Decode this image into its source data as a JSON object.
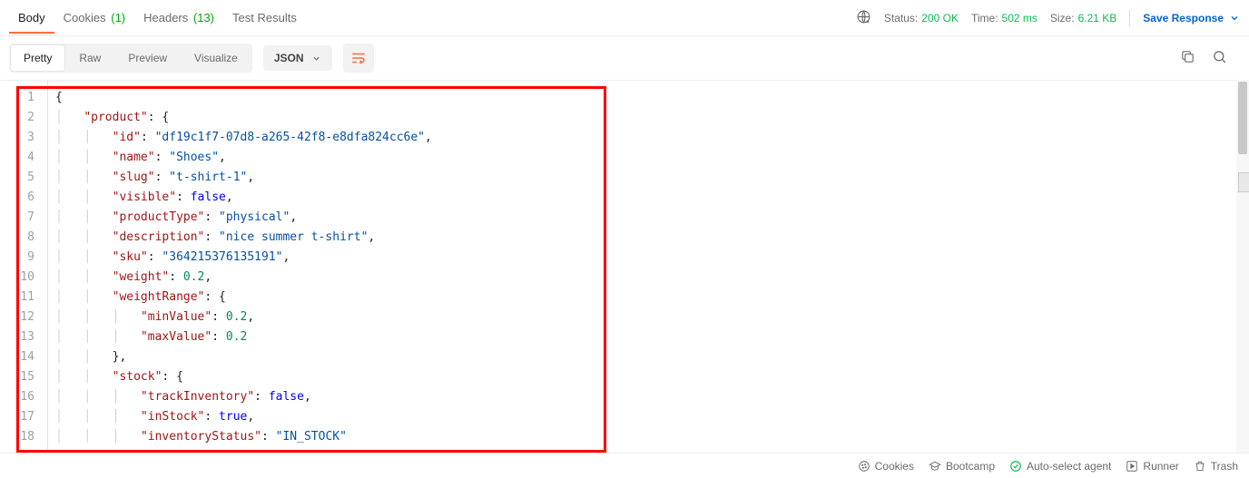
{
  "tabs": {
    "body": "Body",
    "cookies": {
      "label": "Cookies",
      "count": "(1)"
    },
    "headers": {
      "label": "Headers",
      "count": "(13)"
    },
    "test_results": "Test Results"
  },
  "status_bar": {
    "status_label": "Status:",
    "status_value": "200 OK",
    "time_label": "Time:",
    "time_value": "502 ms",
    "size_label": "Size:",
    "size_value": "6.21 KB",
    "save_response": "Save Response"
  },
  "view": {
    "pretty": "Pretty",
    "raw": "Raw",
    "preview": "Preview",
    "visualize": "Visualize",
    "format": "JSON"
  },
  "code_lines": [
    {
      "n": 1,
      "indent": 0,
      "tokens": [
        {
          "t": "punc",
          "v": "{"
        }
      ]
    },
    {
      "n": 2,
      "indent": 1,
      "tokens": [
        {
          "t": "key",
          "v": "\"product\""
        },
        {
          "t": "punc",
          "v": ": "
        },
        {
          "t": "punc",
          "v": "{"
        }
      ]
    },
    {
      "n": 3,
      "indent": 2,
      "tokens": [
        {
          "t": "key",
          "v": "\"id\""
        },
        {
          "t": "punc",
          "v": ": "
        },
        {
          "t": "str",
          "v": "\"df19c1f7-07d8-a265-42f8-e8dfa824cc6e\""
        },
        {
          "t": "punc",
          "v": ","
        }
      ]
    },
    {
      "n": 4,
      "indent": 2,
      "tokens": [
        {
          "t": "key",
          "v": "\"name\""
        },
        {
          "t": "punc",
          "v": ": "
        },
        {
          "t": "str",
          "v": "\"Shoes\""
        },
        {
          "t": "punc",
          "v": ","
        }
      ]
    },
    {
      "n": 5,
      "indent": 2,
      "tokens": [
        {
          "t": "key",
          "v": "\"slug\""
        },
        {
          "t": "punc",
          "v": ": "
        },
        {
          "t": "str",
          "v": "\"t-shirt-1\""
        },
        {
          "t": "punc",
          "v": ","
        }
      ]
    },
    {
      "n": 6,
      "indent": 2,
      "tokens": [
        {
          "t": "key",
          "v": "\"visible\""
        },
        {
          "t": "punc",
          "v": ": "
        },
        {
          "t": "bool",
          "v": "false"
        },
        {
          "t": "punc",
          "v": ","
        }
      ]
    },
    {
      "n": 7,
      "indent": 2,
      "tokens": [
        {
          "t": "key",
          "v": "\"productType\""
        },
        {
          "t": "punc",
          "v": ": "
        },
        {
          "t": "str",
          "v": "\"physical\""
        },
        {
          "t": "punc",
          "v": ","
        }
      ]
    },
    {
      "n": 8,
      "indent": 2,
      "tokens": [
        {
          "t": "key",
          "v": "\"description\""
        },
        {
          "t": "punc",
          "v": ": "
        },
        {
          "t": "str",
          "v": "\"nice summer t-shirt\""
        },
        {
          "t": "punc",
          "v": ","
        }
      ]
    },
    {
      "n": 9,
      "indent": 2,
      "tokens": [
        {
          "t": "key",
          "v": "\"sku\""
        },
        {
          "t": "punc",
          "v": ": "
        },
        {
          "t": "str",
          "v": "\"364215376135191\""
        },
        {
          "t": "punc",
          "v": ","
        }
      ]
    },
    {
      "n": 10,
      "indent": 2,
      "tokens": [
        {
          "t": "key",
          "v": "\"weight\""
        },
        {
          "t": "punc",
          "v": ": "
        },
        {
          "t": "num",
          "v": "0.2"
        },
        {
          "t": "punc",
          "v": ","
        }
      ]
    },
    {
      "n": 11,
      "indent": 2,
      "tokens": [
        {
          "t": "key",
          "v": "\"weightRange\""
        },
        {
          "t": "punc",
          "v": ": "
        },
        {
          "t": "punc",
          "v": "{"
        }
      ]
    },
    {
      "n": 12,
      "indent": 3,
      "tokens": [
        {
          "t": "key",
          "v": "\"minValue\""
        },
        {
          "t": "punc",
          "v": ": "
        },
        {
          "t": "num",
          "v": "0.2"
        },
        {
          "t": "punc",
          "v": ","
        }
      ]
    },
    {
      "n": 13,
      "indent": 3,
      "tokens": [
        {
          "t": "key",
          "v": "\"maxValue\""
        },
        {
          "t": "punc",
          "v": ": "
        },
        {
          "t": "num",
          "v": "0.2"
        }
      ]
    },
    {
      "n": 14,
      "indent": 2,
      "tokens": [
        {
          "t": "punc",
          "v": "},"
        }
      ]
    },
    {
      "n": 15,
      "indent": 2,
      "tokens": [
        {
          "t": "key",
          "v": "\"stock\""
        },
        {
          "t": "punc",
          "v": ": "
        },
        {
          "t": "punc",
          "v": "{"
        }
      ]
    },
    {
      "n": 16,
      "indent": 3,
      "tokens": [
        {
          "t": "key",
          "v": "\"trackInventory\""
        },
        {
          "t": "punc",
          "v": ": "
        },
        {
          "t": "bool",
          "v": "false"
        },
        {
          "t": "punc",
          "v": ","
        }
      ]
    },
    {
      "n": 17,
      "indent": 3,
      "tokens": [
        {
          "t": "key",
          "v": "\"inStock\""
        },
        {
          "t": "punc",
          "v": ": "
        },
        {
          "t": "bool",
          "v": "true"
        },
        {
          "t": "punc",
          "v": ","
        }
      ]
    },
    {
      "n": 18,
      "indent": 3,
      "tokens": [
        {
          "t": "key",
          "v": "\"inventoryStatus\""
        },
        {
          "t": "punc",
          "v": ": "
        },
        {
          "t": "str",
          "v": "\"IN_STOCK\""
        }
      ]
    }
  ],
  "footer": {
    "cookies": "Cookies",
    "bootcamp": "Bootcamp",
    "auto_select": "Auto-select agent",
    "runner": "Runner",
    "trash": "Trash"
  }
}
